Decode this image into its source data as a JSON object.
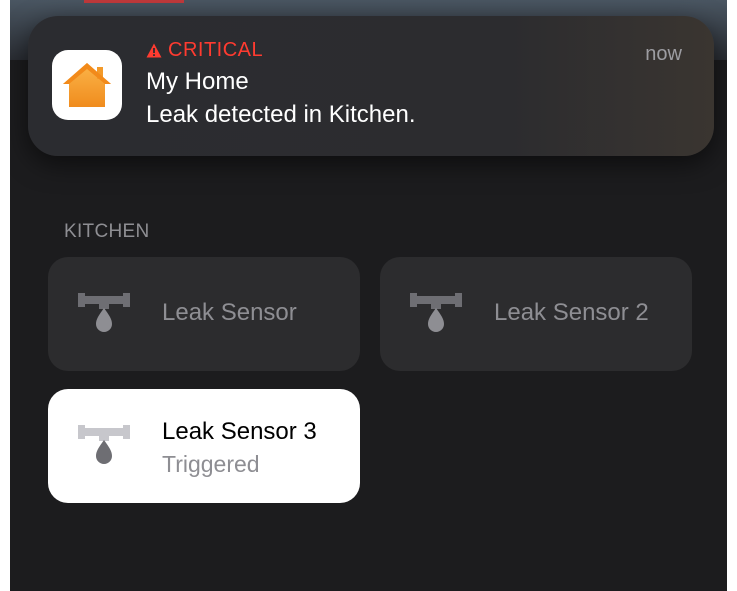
{
  "notification": {
    "badge": "CRITICAL",
    "app_name": "My Home",
    "message": "Leak detected in Kitchen.",
    "time": "now",
    "app_icon": "home-app-icon",
    "badge_icon": "warning-triangle-icon",
    "badge_color": "#ff3b30"
  },
  "room": {
    "label": "KITCHEN",
    "accessories": [
      {
        "name": "Leak Sensor",
        "icon": "leak-sensor-icon",
        "state": "inactive"
      },
      {
        "name": "Leak Sensor 2",
        "icon": "leak-sensor-icon",
        "state": "inactive"
      },
      {
        "name": "Leak Sensor 3",
        "status": "Triggered",
        "icon": "leak-sensor-icon",
        "state": "active"
      }
    ]
  },
  "colors": {
    "background": "#1c1c1e",
    "tile": "#2c2c2e",
    "tile_active": "#ffffff",
    "icon_orange": "#f7a234"
  }
}
